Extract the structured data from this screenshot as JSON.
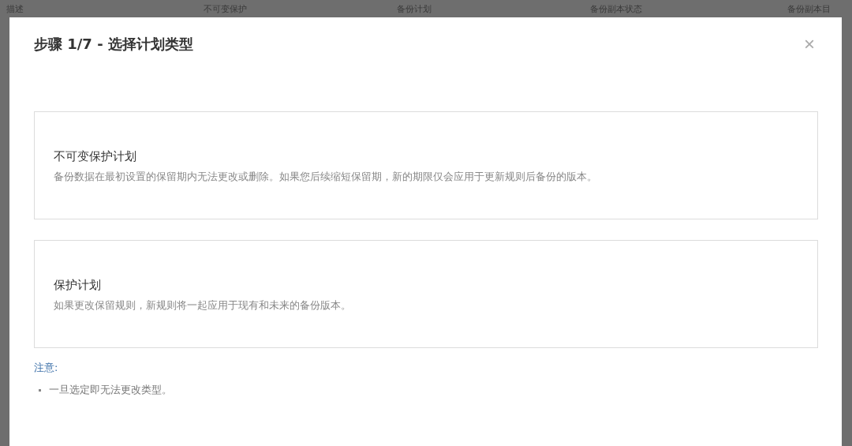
{
  "background_table": {
    "columns": [
      "描述",
      "不可变保护",
      "备份计划",
      "备份副本状态",
      "备份副本目"
    ]
  },
  "dialog": {
    "title": "步骤 1/7 - 选择计划类型",
    "close": "×",
    "options": [
      {
        "title": "不可变保护计划",
        "description": "备份数据在最初设置的保留期内无法更改或删除。如果您后续缩短保留期，新的期限仅会应用于更新规则后备份的版本。"
      },
      {
        "title": "保护计划",
        "description": "如果更改保留规则，新规则将一起应用于现有和未来的备份版本。"
      }
    ],
    "note": {
      "label": "注意:",
      "items": [
        "一旦选定即无法更改类型。"
      ]
    }
  }
}
